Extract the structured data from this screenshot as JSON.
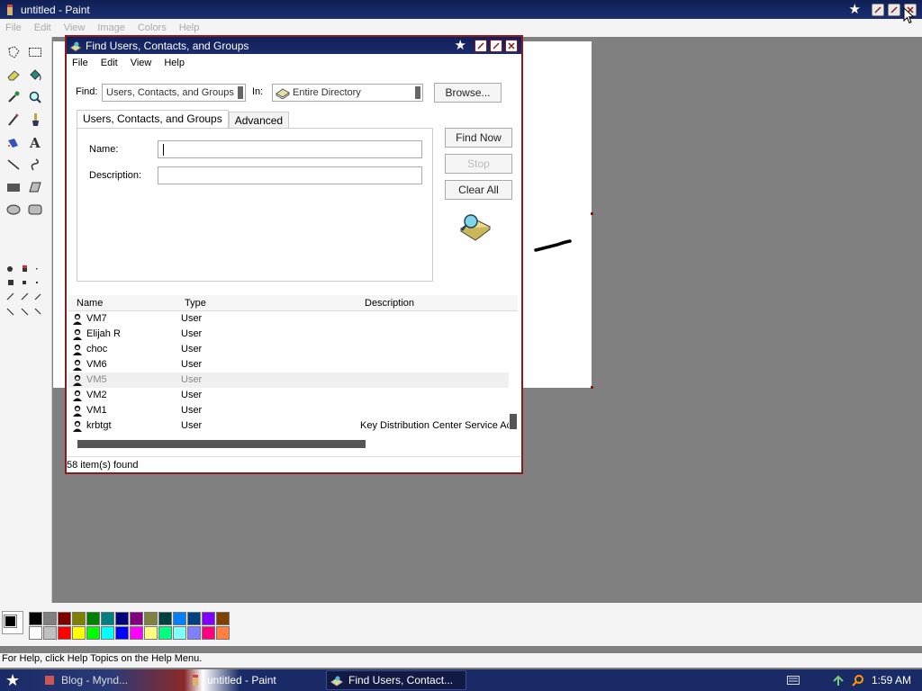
{
  "paint": {
    "title": "untitled - Paint",
    "menu": [
      "File",
      "Edit",
      "View",
      "Image",
      "Colors",
      "Help"
    ],
    "status": "For Help, click Help Topics on the Help Menu."
  },
  "dialog": {
    "title": "Find Users, Contacts, and Groups",
    "menu": [
      "File",
      "Edit",
      "View",
      "Help"
    ],
    "find_label": "Find:",
    "find_value": "Users, Contacts, and Groups",
    "in_label": "In:",
    "in_value": "Entire Directory",
    "browse_label": "Browse...",
    "tabs": [
      "Users, Contacts, and Groups",
      "Advanced"
    ],
    "name_label": "Name:",
    "name_value": "",
    "description_label": "Description:",
    "description_value": "",
    "find_now_label": "Find Now",
    "stop_label": "Stop",
    "clear_all_label": "Clear All",
    "columns": [
      "Name",
      "Type",
      "Description"
    ],
    "rows": [
      {
        "name": "VM7",
        "type": "User",
        "desc": ""
      },
      {
        "name": "Elijah R",
        "type": "User",
        "desc": ""
      },
      {
        "name": "choc",
        "type": "User",
        "desc": ""
      },
      {
        "name": "VM6",
        "type": "User",
        "desc": ""
      },
      {
        "name": "VM5",
        "type": "User",
        "desc": ""
      },
      {
        "name": "VM2",
        "type": "User",
        "desc": ""
      },
      {
        "name": "VM1",
        "type": "User",
        "desc": ""
      },
      {
        "name": "krbtgt",
        "type": "User",
        "desc": "Key Distribution Center Service Ac"
      }
    ],
    "status": "58 item(s) found"
  },
  "palette": {
    "foreground": "#000000",
    "background": "#ffffff",
    "colors": [
      "#000000",
      "#808080",
      "#800000",
      "#808000",
      "#008000",
      "#008080",
      "#000080",
      "#800080",
      "#808040",
      "#004040",
      "#0080ff",
      "#004080",
      "#8000ff",
      "#804000",
      "#ffffff",
      "#c0c0c0",
      "#ff0000",
      "#ffff00",
      "#00ff00",
      "#00ffff",
      "#0000ff",
      "#ff00ff",
      "#ffff80",
      "#00ff80",
      "#80ffff",
      "#8080ff",
      "#ff0080",
      "#ff8040"
    ]
  },
  "taskbar": {
    "buttons": [
      "Blog - Mynd...",
      "untitled - Paint",
      "Find Users, Contact..."
    ],
    "clock": "1:59 AM"
  }
}
